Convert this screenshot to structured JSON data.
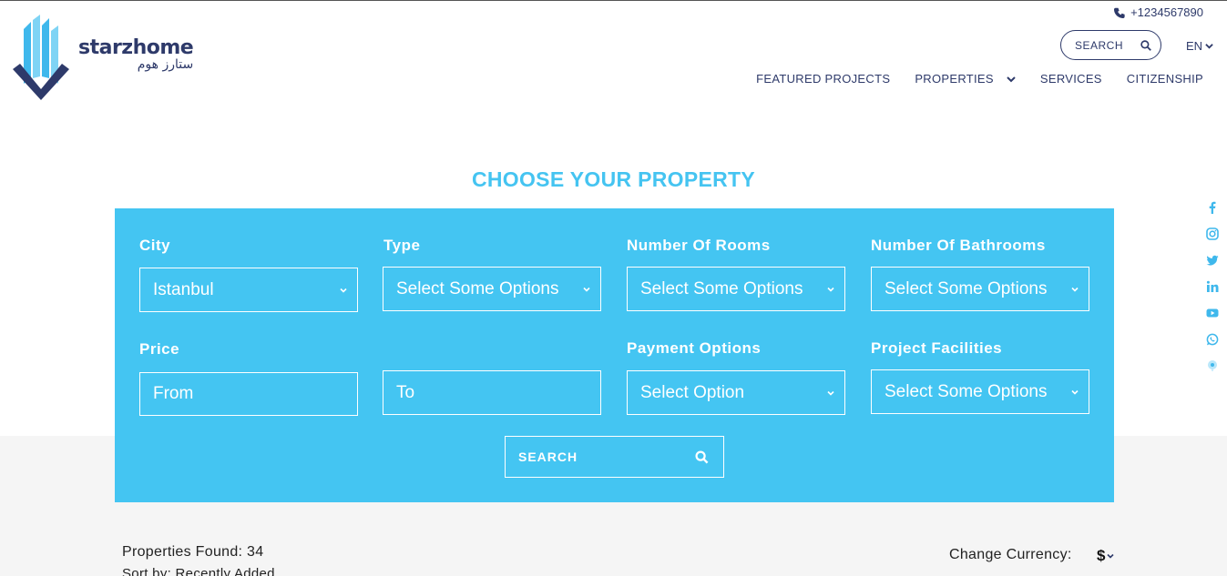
{
  "header": {
    "logo_text": "starzhome",
    "logo_text_ar": "ستارز هوم",
    "phone": "+1234567890",
    "search_label": "SEARCH",
    "language": "EN",
    "nav": [
      {
        "label": "FEATURED PROJECTS",
        "has_dropdown": false
      },
      {
        "label": "PROPERTIES",
        "has_dropdown": true
      },
      {
        "label": "SERVICES",
        "has_dropdown": false
      },
      {
        "label": "CITIZENSHIP",
        "has_dropdown": false
      }
    ]
  },
  "social_icons": [
    "facebook-icon",
    "instagram-icon",
    "twitter-icon",
    "linkedin-icon",
    "youtube-icon",
    "whatsapp-icon",
    "map-pin-icon"
  ],
  "page_title": "CHOOSE YOUR PROPERTY",
  "filters": {
    "city": {
      "label": "City",
      "value": "Istanbul"
    },
    "type": {
      "label": "Type",
      "value": "Select Some Options"
    },
    "rooms": {
      "label": "Number Of Rooms",
      "value": "Select Some Options"
    },
    "bathrooms": {
      "label": "Number Of Bathrooms",
      "value": "Select Some Options"
    },
    "price": {
      "label": "Price",
      "from_placeholder": "From",
      "to_placeholder": "To"
    },
    "payment": {
      "label": "Payment Options",
      "value": "Select Option"
    },
    "facilities": {
      "label": "Project Facilities",
      "value": "Select Some Options"
    },
    "search_label": "SEARCH"
  },
  "results": {
    "found_text": "Properties Found: 34",
    "sort_text": "Sort by: Recently Added",
    "currency_label": "Change Currency:",
    "currency_value": "$"
  },
  "colors": {
    "accent": "#44c5f2",
    "brand_dark": "#2e3a6a"
  }
}
